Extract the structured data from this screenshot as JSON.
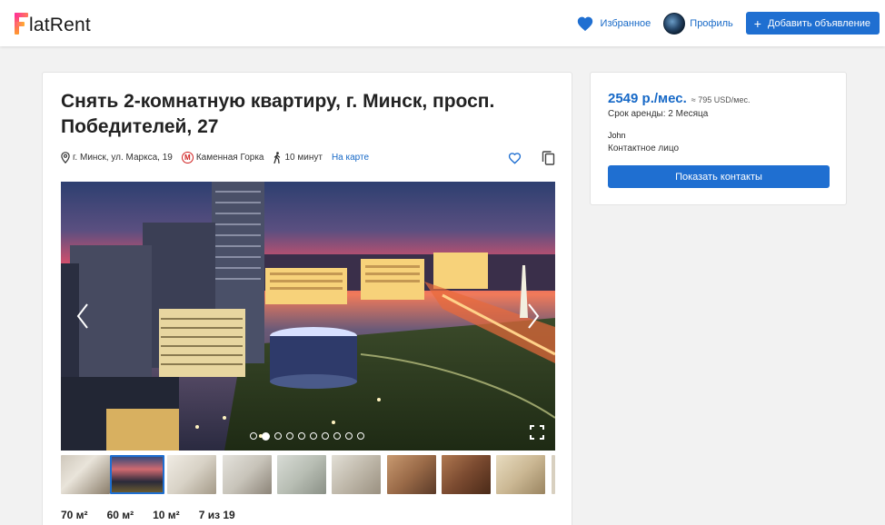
{
  "header": {
    "logo_text": "latRent",
    "favorites_label": "Избранное",
    "profile_label": "Профиль",
    "add_listing_label": "Добавить объявление",
    "accent_color": "#1f6fd1"
  },
  "listing": {
    "title": "Снять 2-комнатную квартиру, г. Минск, просп. Победителей, 27",
    "address": "г. Минск, ул. Маркса, 19",
    "metro": "Каменная Горка",
    "metro_icon": "М",
    "walk_time": "10 минут",
    "map_link": "На карте",
    "gallery": {
      "photo_count": 10,
      "active_index": 1
    },
    "stats": [
      "70 м²",
      "60 м²",
      "10 м²",
      "7 из 19"
    ]
  },
  "side": {
    "price": "2549 р./мес.",
    "price_usd": "≈ 795 USD/мес.",
    "lease_term": "Срок аренды: 2 Месяца",
    "owner_name": "John",
    "owner_role": "Контактное лицо",
    "show_contacts_label": "Показать контакты"
  }
}
